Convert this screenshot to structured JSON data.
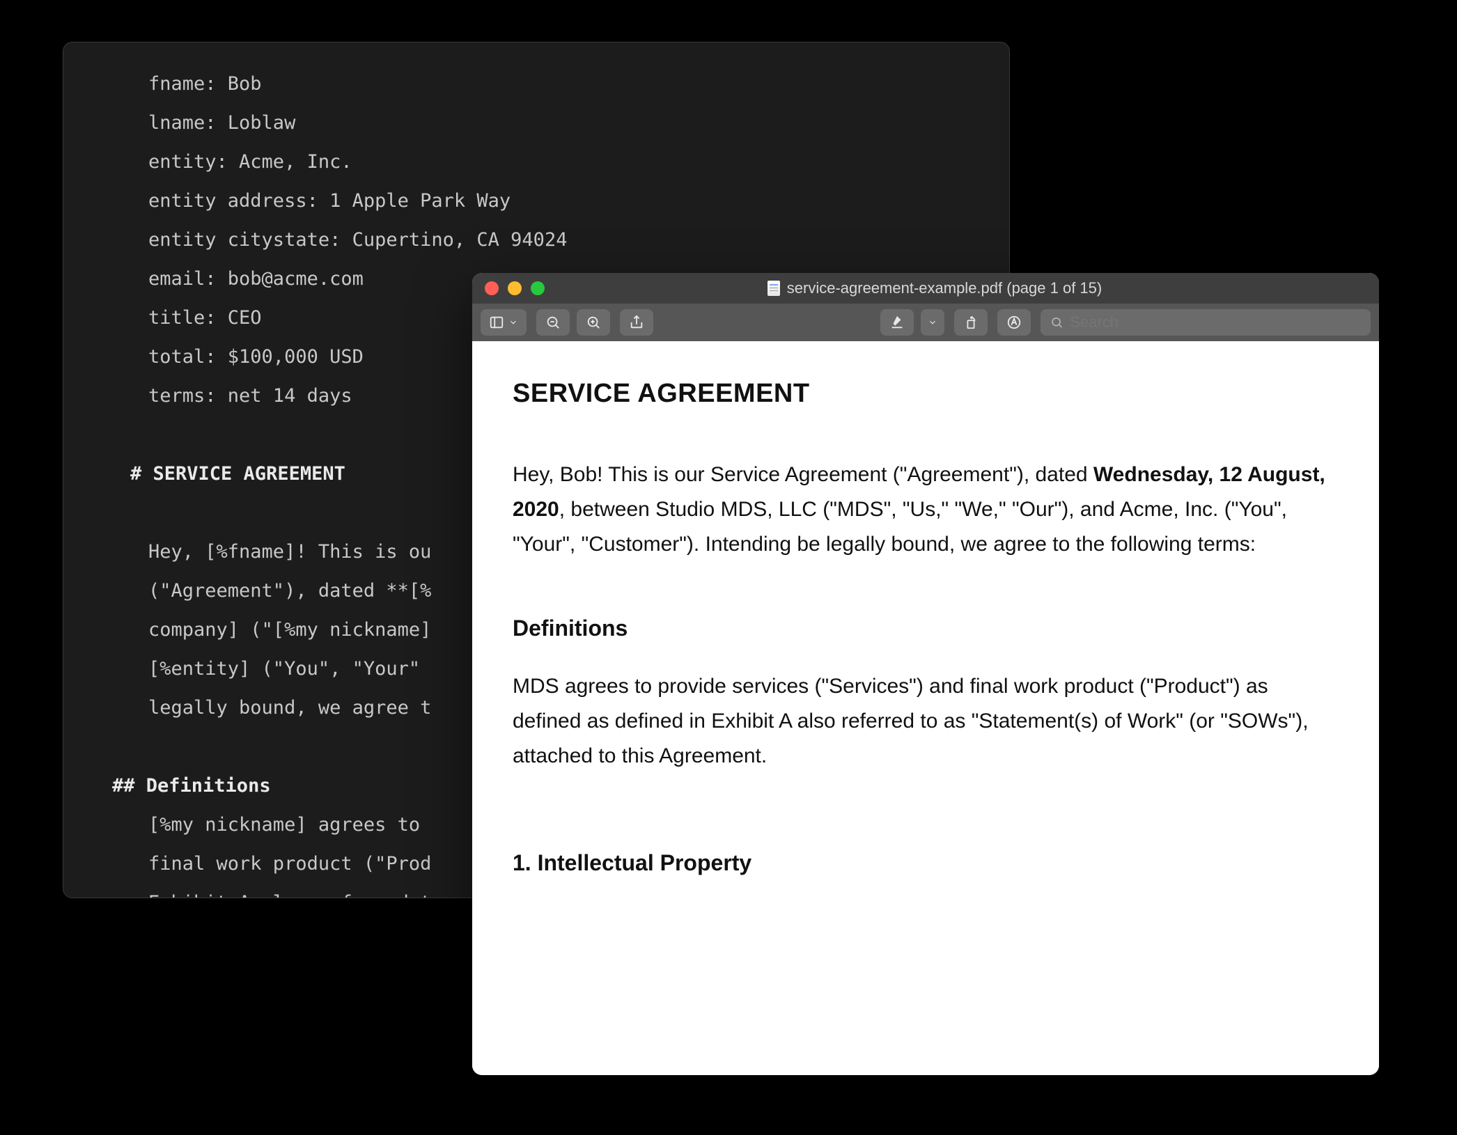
{
  "editor": {
    "lines": [
      {
        "indent": 1,
        "text": "fname: Bob"
      },
      {
        "indent": 1,
        "text": "lname: Loblaw"
      },
      {
        "indent": 1,
        "text": "entity: Acme, Inc."
      },
      {
        "indent": 1,
        "text": "entity address: 1 Apple Park Way"
      },
      {
        "indent": 1,
        "text": "entity citystate: Cupertino, CA 94024"
      },
      {
        "indent": 1,
        "text": "email: bob@acme.com"
      },
      {
        "indent": 1,
        "text": "title: CEO"
      },
      {
        "indent": 1,
        "text": "total: $100,000 USD"
      },
      {
        "indent": 1,
        "text": "terms: net 14 days"
      },
      {
        "indent": 1,
        "text": ""
      },
      {
        "indent": 0.5,
        "heading": true,
        "text": "# SERVICE AGREEMENT"
      },
      {
        "indent": 1,
        "text": ""
      },
      {
        "indent": 1,
        "text": "Hey, [%fname]! This is ou"
      },
      {
        "indent": 1,
        "text": "(\"Agreement\"), dated **[%"
      },
      {
        "indent": 1,
        "text": "company] (\"[%my nickname]"
      },
      {
        "indent": 1,
        "text": "[%entity] (\"You\", \"Your\""
      },
      {
        "indent": 1,
        "text": "legally bound, we agree t"
      },
      {
        "indent": 1,
        "text": ""
      },
      {
        "indent": 0,
        "heading": true,
        "text": "## Definitions"
      },
      {
        "indent": 1,
        "text": "[%my nickname] agrees to "
      },
      {
        "indent": 1,
        "text": "final work product (\"Prod"
      },
      {
        "indent": 1,
        "text": "Exhibit A also referred t"
      }
    ]
  },
  "preview": {
    "window_title": "service-agreement-example.pdf (page 1 of 15)",
    "search_placeholder": "Search",
    "doc": {
      "title": "SERVICE AGREEMENT",
      "intro_pre": "Hey, Bob! This is our Service Agreement (\"Agreement\"), dated ",
      "intro_date": "Wednesday, 12 August, 2020",
      "intro_post": ", between Studio MDS, LLC (\"MDS\", \"Us,\" \"We,\" \"Our\"), and Acme, Inc. (\"You\", \"Your\", \"Customer\"). Intending be legally bound, we agree to the following terms:",
      "definitions_heading": "Definitions",
      "definitions_body": "MDS agrees to provide services (\"Services\") and final work product (\"Product\") as defined as defined in Exhibit A also referred to as \"Statement(s) of Work\" (or \"SOWs\"), attached to this Agreement.",
      "section1_heading": "1. Intellectual Property"
    }
  }
}
